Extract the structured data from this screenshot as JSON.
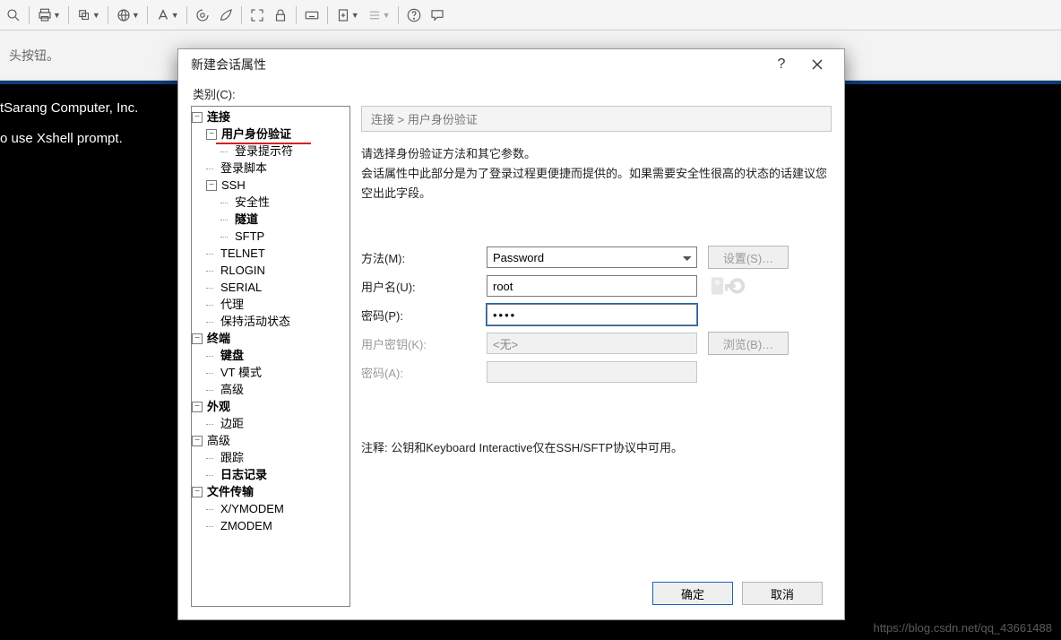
{
  "toolbar_icons": [
    "search",
    "print",
    "copy",
    "globe",
    "font",
    "swirl",
    "leaf",
    "expand",
    "lock",
    "keyboard",
    "new-doc",
    "list",
    "help",
    "chat"
  ],
  "banner_text": "头按钮。",
  "terminal_lines": [
    "tSarang Computer, Inc.",
    "",
    "o use Xshell prompt."
  ],
  "watermark": "https://blog.csdn.net/qq_43661488",
  "dialog": {
    "title": "新建会话属性",
    "category_label": "类别(C):",
    "breadcrumb": "连接 > 用户身份验证",
    "desc_line1": "请选择身份验证方法和其它参数。",
    "desc_line2": "会话属性中此部分是为了登录过程更便捷而提供的。如果需要安全性很高的状态的话建议您空出此字段。",
    "labels": {
      "method": "方法(M):",
      "username": "用户名(U):",
      "password": "密码(P):",
      "userkey": "用户密钥(K):",
      "passA": "密码(A):"
    },
    "values": {
      "method": "Password",
      "username": "root",
      "password": "●●●●",
      "userkey": "<无>"
    },
    "buttons": {
      "settings": "设置(S)…",
      "browse": "浏览(B)…",
      "ok": "确定",
      "cancel": "取消"
    },
    "note": "注释: 公钥和Keyboard Interactive仅在SSH/SFTP协议中可用。"
  },
  "tree": {
    "n_connection": "连接",
    "n_auth": "用户身份验证",
    "n_login_prompt": "登录提示符",
    "n_login_script": "登录脚本",
    "n_ssh": "SSH",
    "n_security": "安全性",
    "n_tunnel": "隧道",
    "n_sftp": "SFTP",
    "n_telnet": "TELNET",
    "n_rlogin": "RLOGIN",
    "n_serial": "SERIAL",
    "n_proxy": "代理",
    "n_keepalive": "保持活动状态",
    "n_terminal": "终端",
    "n_keyboard": "键盘",
    "n_vt": "VT 模式",
    "n_advanced1": "高级",
    "n_appearance": "外观",
    "n_margin": "边距",
    "n_advanced2": "高级",
    "n_trace": "跟踪",
    "n_log": "日志记录",
    "n_filetrans": "文件传输",
    "n_xymodem": "X/YMODEM",
    "n_zmodem": "ZMODEM"
  }
}
